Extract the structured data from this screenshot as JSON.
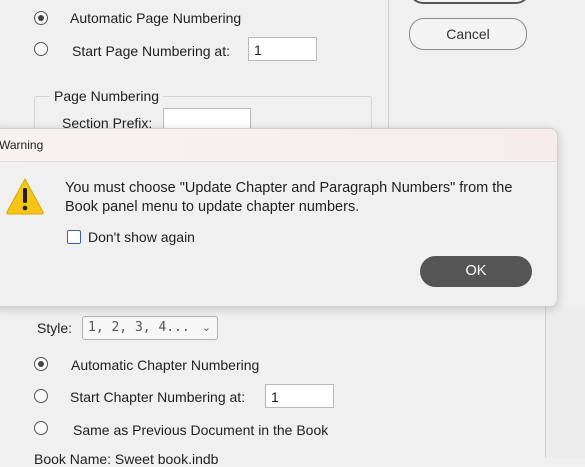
{
  "background": {
    "auto_page_label": "Automatic Page Numbering",
    "start_page_label": "Start Page Numbering at:",
    "start_page_value": "1",
    "cancel_label": "Cancel",
    "page_numbering_group": "Page Numbering",
    "section_prefix_label": "Section Prefix:",
    "style_label": "Style:",
    "style_value": "1, 2, 3, 4...",
    "auto_chapter_label": "Automatic Chapter Numbering",
    "start_chapter_label": "Start Chapter Numbering at:",
    "start_chapter_value": "1",
    "same_as_previous_label": "Same as Previous Document in the Book",
    "cut_off_label": "Book Name: Sweet book.indb"
  },
  "warning": {
    "title": "Warning",
    "message": "You must choose \"Update Chapter and Paragraph Numbers\" from the Book panel menu to update chapter numbers.",
    "checkbox_label": "Don't show again",
    "ok_label": "OK",
    "icon": "warning-triangle-icon",
    "icon_color": "#f5c518"
  }
}
